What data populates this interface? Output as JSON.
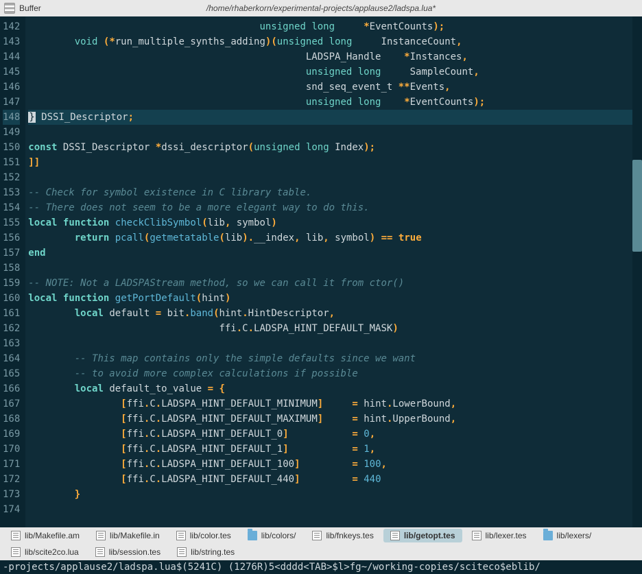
{
  "header": {
    "buffer_label": "Buffer",
    "filepath": "/home/rhaberkorn/experimental-projects/applause2/ladspa.lua*"
  },
  "gutter": {
    "start": 142,
    "end": 174,
    "current": 148
  },
  "code_lines": [
    {
      "n": 142,
      "html": "                                        <span class='type'>unsigned</span> <span class='type'>long</span>     <span class='op'>*</span>EventCounts<span class='op'>)</span><span class='op'>;</span>"
    },
    {
      "n": 143,
      "html": "        <span class='type'>void</span> <span class='op'>(*</span>run_multiple_synths_adding<span class='op'>)</span><span class='op'>(</span><span class='type'>unsigned</span> <span class='type'>long</span>     InstanceCount<span class='op'>,</span>"
    },
    {
      "n": 144,
      "html": "                                                LADSPA_Handle    <span class='op'>*</span>Instances<span class='op'>,</span>"
    },
    {
      "n": 145,
      "html": "                                                <span class='type'>unsigned</span> <span class='type'>long</span>     SampleCount<span class='op'>,</span>"
    },
    {
      "n": 146,
      "html": "                                                snd_seq_event_t <span class='op'>**</span>Events<span class='op'>,</span>"
    },
    {
      "n": 147,
      "html": "                                                <span class='type'>unsigned</span> <span class='type'>long</span>    <span class='op'>*</span>EventCounts<span class='op'>)</span><span class='op'>;</span>"
    },
    {
      "n": 148,
      "current": true,
      "html": "<span class='cursor'>}</span> DSSI_Descriptor<span class='op'>;</span>"
    },
    {
      "n": 149,
      "html": ""
    },
    {
      "n": 150,
      "html": "<span class='kw'>const</span> DSSI_Descriptor <span class='op'>*</span>dssi_descriptor<span class='op'>(</span><span class='type'>unsigned</span> <span class='type'>long</span> Index<span class='op'>)</span><span class='op'>;</span>"
    },
    {
      "n": 151,
      "html": "<span class='op'>]]</span>"
    },
    {
      "n": 152,
      "html": ""
    },
    {
      "n": 153,
      "html": "<span class='cmt'>-- Check for symbol existence in C library table.</span>"
    },
    {
      "n": 154,
      "html": "<span class='cmt'>-- There does not seem to be a more elegant way to do this.</span>"
    },
    {
      "n": 155,
      "html": "<span class='kw'>local</span> <span class='kw'>function</span> <span class='fn'>checkClibSymbol</span><span class='op'>(</span>lib<span class='op'>,</span> symbol<span class='op'>)</span>"
    },
    {
      "n": 156,
      "html": "        <span class='kw'>return</span> <span class='fn'>pcall</span><span class='op'>(</span><span class='fn'>getmetatable</span><span class='op'>(</span>lib<span class='op'>)</span><span class='op'>.</span>__index<span class='op'>,</span> lib<span class='op'>,</span> symbol<span class='op'>)</span> <span class='op'>==</span> <span class='bool'>true</span>"
    },
    {
      "n": 157,
      "html": "<span class='kw'>end</span>"
    },
    {
      "n": 158,
      "html": ""
    },
    {
      "n": 159,
      "html": "<span class='cmt'>-- NOTE: Not a LADSPAStream method, so we can call it from ctor()</span>"
    },
    {
      "n": 160,
      "html": "<span class='kw'>local</span> <span class='kw'>function</span> <span class='fn'>getPortDefault</span><span class='op'>(</span>hint<span class='op'>)</span>"
    },
    {
      "n": 161,
      "html": "        <span class='kw'>local</span> default <span class='op'>=</span> bit<span class='op'>.</span><span class='fn'>band</span><span class='op'>(</span>hint<span class='op'>.</span>HintDescriptor<span class='op'>,</span>"
    },
    {
      "n": 162,
      "html": "                                 ffi<span class='op'>.</span>C<span class='op'>.</span>LADSPA_HINT_DEFAULT_MASK<span class='op'>)</span>"
    },
    {
      "n": 163,
      "html": ""
    },
    {
      "n": 164,
      "html": "        <span class='cmt'>-- This map contains only the simple defaults since we want</span>"
    },
    {
      "n": 165,
      "html": "        <span class='cmt'>-- to avoid more complex calculations if possible</span>"
    },
    {
      "n": 166,
      "html": "        <span class='kw'>local</span> default_to_value <span class='op'>=</span> <span class='op'>{</span>"
    },
    {
      "n": 167,
      "html": "                <span class='op'>[</span>ffi<span class='op'>.</span>C<span class='op'>.</span>LADSPA_HINT_DEFAULT_MINIMUM<span class='op'>]</span>     <span class='op'>=</span> hint<span class='op'>.</span>LowerBound<span class='op'>,</span>"
    },
    {
      "n": 168,
      "html": "                <span class='op'>[</span>ffi<span class='op'>.</span>C<span class='op'>.</span>LADSPA_HINT_DEFAULT_MAXIMUM<span class='op'>]</span>     <span class='op'>=</span> hint<span class='op'>.</span>UpperBound<span class='op'>,</span>"
    },
    {
      "n": 169,
      "html": "                <span class='op'>[</span>ffi<span class='op'>.</span>C<span class='op'>.</span>LADSPA_HINT_DEFAULT_0<span class='op'>]</span>           <span class='op'>=</span> <span class='num'>0</span><span class='op'>,</span>"
    },
    {
      "n": 170,
      "html": "                <span class='op'>[</span>ffi<span class='op'>.</span>C<span class='op'>.</span>LADSPA_HINT_DEFAULT_1<span class='op'>]</span>           <span class='op'>=</span> <span class='num'>1</span><span class='op'>,</span>"
    },
    {
      "n": 171,
      "html": "                <span class='op'>[</span>ffi<span class='op'>.</span>C<span class='op'>.</span>LADSPA_HINT_DEFAULT_100<span class='op'>]</span>         <span class='op'>=</span> <span class='num'>100</span><span class='op'>,</span>"
    },
    {
      "n": 172,
      "html": "                <span class='op'>[</span>ffi<span class='op'>.</span>C<span class='op'>.</span>LADSPA_HINT_DEFAULT_440<span class='op'>]</span>         <span class='op'>=</span> <span class='num'>440</span>"
    },
    {
      "n": 173,
      "html": "        <span class='op'>}</span>"
    },
    {
      "n": 174,
      "html": ""
    }
  ],
  "scrollbar": {
    "top_pct": 28,
    "height_pct": 18
  },
  "file_tabs": [
    {
      "icon": "file",
      "label": "lib/Makefile.am",
      "active": false
    },
    {
      "icon": "file",
      "label": "lib/Makefile.in",
      "active": false
    },
    {
      "icon": "file",
      "label": "lib/color.tes",
      "active": false
    },
    {
      "icon": "folder",
      "label": "lib/colors/",
      "active": false
    },
    {
      "icon": "file",
      "label": "lib/fnkeys.tes",
      "active": false
    },
    {
      "icon": "file",
      "label": "lib/getopt.tes",
      "active": true
    },
    {
      "icon": "file",
      "label": "lib/lexer.tes",
      "active": false
    },
    {
      "icon": "folder",
      "label": "lib/lexers/",
      "active": false
    },
    {
      "icon": "file",
      "label": "lib/scite2co.lua",
      "active": false
    },
    {
      "icon": "file",
      "label": "lib/session.tes",
      "active": false
    },
    {
      "icon": "file",
      "label": "lib/string.tes",
      "active": false
    }
  ],
  "status": "-projects/applause2/ladspa.lua$(5241C) (1276R)5<dddd<TAB>$l>fg~/working-copies/sciteco$eblib/"
}
